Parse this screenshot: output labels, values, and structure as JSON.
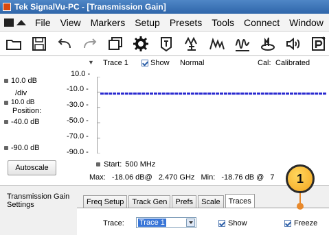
{
  "window": {
    "title": "Tek SignalVu-PC - [Transmission Gain]"
  },
  "menu": {
    "items": [
      "File",
      "View",
      "Markers",
      "Setup",
      "Presets",
      "Tools",
      "Connect",
      "Window"
    ]
  },
  "toolbar": {
    "icons": [
      "open-folder-icon",
      "save-icon",
      "undo-icon",
      "redo-icon",
      "window-icon",
      "gear-icon",
      "marker-tag-icon",
      "peak-antenna-icon",
      "peak-search-icon",
      "waveform-icon",
      "spectrum-icon",
      "speaker-icon",
      "preset-icon"
    ]
  },
  "trace_header": {
    "trace": "Trace 1",
    "show_label": "Show",
    "mode": "Normal",
    "cal_label": "Cal:",
    "cal_value": "Calibrated"
  },
  "scale_panel": {
    "ref_level": "10.0 dB",
    "div_label": "/div",
    "div_value": "10.0 dB",
    "position_label": "Position:",
    "position_value": "-40.0 dB",
    "bottom_value": "-90.0 dB",
    "autoscale_label": "Autoscale"
  },
  "chart_data": {
    "type": "line",
    "y_ticks": [
      "10.0 -",
      "-10.0 -",
      "-30.0 -",
      "-50.0 -",
      "-70.0 -",
      "-90.0 -"
    ],
    "ylim": [
      -90,
      10
    ],
    "series": [
      {
        "values": [
          -12,
          -12,
          -12,
          -12,
          -12,
          -12,
          -12,
          -12,
          -12,
          -12,
          -12,
          -12,
          -12,
          -12,
          -12,
          -12,
          -12,
          -12,
          -12,
          -12,
          -12,
          -12,
          -12,
          -12,
          -12,
          -12,
          -12,
          -12,
          -12,
          -12,
          -12,
          -12,
          -12,
          -12,
          -12,
          -12,
          -12,
          -12,
          -12,
          -12
        ],
        "color": "#2a2ad0"
      }
    ],
    "start_label": "Start:",
    "start_value": "500 MHz"
  },
  "measurements": {
    "max_label": "Max:",
    "max_value": "-18.06 dB@",
    "max_freq": "2.470 GHz",
    "min_label": "Min:",
    "min_value": "-18.76 dB @",
    "min_freq": "7"
  },
  "settings": {
    "title": "Transmission Gain Settings",
    "tabs": [
      "Freq Setup",
      "Track Gen",
      "Prefs",
      "Scale",
      "Traces"
    ],
    "active_tab": "Traces",
    "trace_label": "Trace:",
    "trace_value": "Trace 1",
    "show_label": "Show",
    "freeze_label": "Freeze"
  },
  "callout": {
    "number": "1",
    "color": "#f4a51f"
  }
}
